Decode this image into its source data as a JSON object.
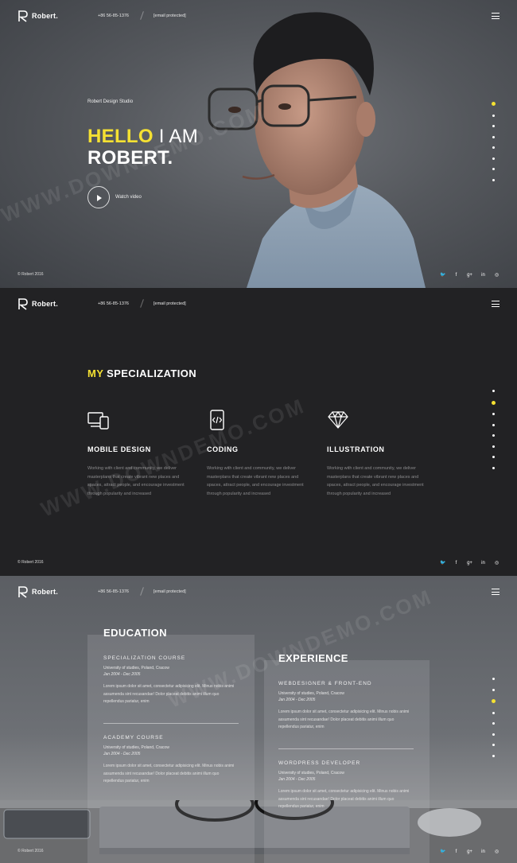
{
  "brand": {
    "name": "Robert."
  },
  "nav": {
    "phone": "+86 56-85-1376",
    "email": "[email protected]"
  },
  "hero": {
    "subtitle": "Robert Design Studio",
    "title_hello": "HELLO",
    "title_iam": "I AM",
    "title_name": "ROBERT.",
    "watch_label": "Watch video"
  },
  "footer": {
    "copyright": "© Robert 2016"
  },
  "social": {
    "twitter_glyph": "🐦",
    "facebook_glyph": "f",
    "gplus_glyph": "g+",
    "linkedin_glyph": "in",
    "dribbble_glyph": "◎"
  },
  "sections": {
    "hero_active_dot": 0,
    "spec_active_dot": 1,
    "edu_active_dot": 2
  },
  "specialization": {
    "title_prefix": "MY",
    "title_rest": "SPECIALIZATION",
    "items": [
      {
        "icon": "devices-icon",
        "title": "MOBILE DESIGN",
        "text": "Working with client and community, we deliver masterplans that create vibrant new places and spaces, attract people, and encourage investment through popularity and increased"
      },
      {
        "icon": "code-phone-icon",
        "title": "CODING",
        "text": "Working with client and community, we deliver masterplans that create vibrant new places and spaces, attract people, and encourage investment through popularity and increased"
      },
      {
        "icon": "diamond-icon",
        "title": "ILLUSTRATION",
        "text": "Working with client and community, we deliver masterplans that create vibrant new places and spaces, attract people, and encourage investment through popularity and increased"
      }
    ]
  },
  "education": {
    "title": "EDUCATION",
    "entries": [
      {
        "head": "SPECIALIZATION COURSE",
        "org": "University of studies, Poland, Cracow",
        "date": "Jan 2004 - Dec 2005",
        "text": "Lorem ipsum dolor sit amet, consectetur adipisicing elit. Minus nobis animi assumenda sint recusandae! Dolor placeat debitis animi illum quo repellendus pariatur, enim"
      },
      {
        "head": "ACADEMY COURSE",
        "org": "University of studies, Poland, Cracow",
        "date": "Jan 2004 - Dec 2005",
        "text": "Lorem ipsum dolor sit amet, consectetur adipisicing elit. Minus nobis animi assumenda sint recusandae! Dolor placeat debitis animi illum quo repellendus pariatur, enim"
      }
    ]
  },
  "experience": {
    "title": "EXPERIENCE",
    "entries": [
      {
        "head": "WEBDESIGNER & FRONT-END",
        "org": "University of studies, Poland, Cracow",
        "date": "Jan 2004 - Dec 2005",
        "text": "Lorem ipsum dolor sit amet, consectetur adipisicing elit. Minus nobis animi assumenda sint recusandae! Dolor placeat debitis animi illum quo repellendus pariatur, enim"
      },
      {
        "head": "WORDPRESS DEVELOPER",
        "org": "University of studies, Poland, Cracow",
        "date": "Jan 2004 - Dec 2005",
        "text": "Lorem ipsum dolor sit amet, consectetur adipisicing elit. Minus nobis animi assumenda sint recusandae! Dolor placeat debitis animi illum quo repellendus pariatur, enim"
      }
    ]
  },
  "watermark": {
    "text": "WWW.DOWNDEMO.COM"
  },
  "colors": {
    "accent": "#f5e132",
    "dark": "#222224"
  }
}
